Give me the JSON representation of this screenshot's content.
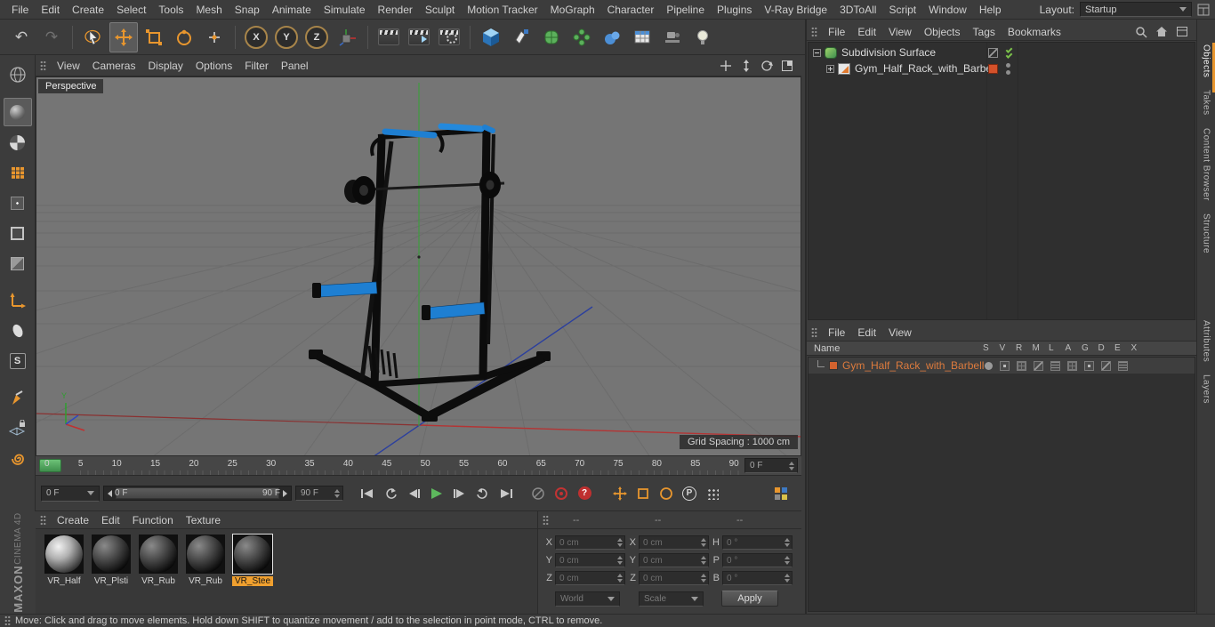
{
  "menubar": {
    "items": [
      "File",
      "Edit",
      "Create",
      "Select",
      "Tools",
      "Mesh",
      "Snap",
      "Animate",
      "Simulate",
      "Render",
      "Sculpt",
      "Motion Tracker",
      "MoGraph",
      "Character",
      "Pipeline",
      "Plugins",
      "V-Ray Bridge",
      "3DToAll",
      "Script",
      "Window",
      "Help"
    ],
    "layout_label": "Layout:",
    "layout_value": "Startup"
  },
  "toolbar": {
    "axis_buttons": [
      "X",
      "Y",
      "Z"
    ]
  },
  "sidebar": {
    "snap_label": "S"
  },
  "viewport": {
    "menu_items": [
      "View",
      "Cameras",
      "Display",
      "Options",
      "Filter",
      "Panel"
    ],
    "camera_label": "Perspective",
    "grid_spacing": "Grid Spacing : 1000 cm",
    "axis_y_label": "Y"
  },
  "objects_panel": {
    "menu_items": [
      "File",
      "Edit",
      "View",
      "Objects",
      "Tags",
      "Bookmarks"
    ],
    "rows": [
      {
        "label": "Subdivision Surface"
      },
      {
        "label": "Gym_Half_Rack_with_Barbell"
      }
    ]
  },
  "layers_panel": {
    "menu_items": [
      "File",
      "Edit",
      "View"
    ],
    "name_header": "Name",
    "columns": [
      "S",
      "V",
      "R",
      "M",
      "L",
      "A",
      "G",
      "D",
      "E",
      "X"
    ],
    "rows": [
      {
        "label": "Gym_Half_Rack_with_Barbell"
      }
    ]
  },
  "right_tabs": {
    "top": [
      "Objects",
      "Takes",
      "Content Browser",
      "Structure"
    ],
    "bottom": [
      "Attributes",
      "Layers"
    ]
  },
  "timeline": {
    "ticks": [
      "0",
      "5",
      "10",
      "15",
      "20",
      "25",
      "30",
      "35",
      "40",
      "45",
      "50",
      "55",
      "60",
      "65",
      "70",
      "75",
      "80",
      "85",
      "90"
    ],
    "frame_field": "0 F",
    "current_frame_dropdown": "0 F",
    "slider_start": "0 F",
    "slider_end": "90 F",
    "end_field": "90 F"
  },
  "playback": {
    "p_label": "P",
    "help_label": "?"
  },
  "materials_panel": {
    "menu_items": [
      "Create",
      "Edit",
      "Function",
      "Texture"
    ],
    "materials": [
      {
        "label": "VR_Half",
        "selected": false
      },
      {
        "label": "VR_Plsti",
        "selected": false
      },
      {
        "label": "VR_Rub",
        "selected": false
      },
      {
        "label": "VR_Rub",
        "selected": false
      },
      {
        "label": "VR_Stee",
        "selected": true
      }
    ]
  },
  "coordinates_panel": {
    "header_placeholders": [
      "--",
      "--",
      "--"
    ],
    "position_labels": [
      "X",
      "Y",
      "Z"
    ],
    "size_labels": [
      "X",
      "Y",
      "Z"
    ],
    "rotation_labels": [
      "H",
      "P",
      "B"
    ],
    "position_values": [
      "0 cm",
      "0 cm",
      "0 cm"
    ],
    "size_values": [
      "0 cm",
      "0 cm",
      "0 cm"
    ],
    "rotation_values": [
      "0 °",
      "0 °",
      "0 °"
    ],
    "world_dropdown": "World",
    "scale_dropdown": "Scale",
    "apply_button": "Apply"
  },
  "status_bar": {
    "text": "Move: Click and drag to move elements. Hold down SHIFT to quantize movement / add to the selection in point mode, CTRL to remove."
  },
  "branding": {
    "maxon": "MAXON",
    "cinema": "CINEMA 4D"
  }
}
